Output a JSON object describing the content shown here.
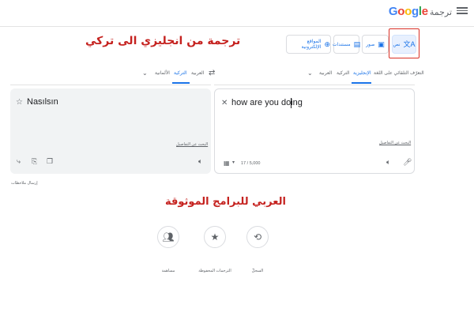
{
  "header": {
    "logo_letters": [
      {
        "char": "G",
        "color": "#4285f4"
      },
      {
        "char": "o",
        "color": "#ea4335"
      },
      {
        "char": "o",
        "color": "#fbbc05"
      },
      {
        "char": "g",
        "color": "#4285f4"
      },
      {
        "char": "l",
        "color": "#34a853"
      },
      {
        "char": "e",
        "color": "#ea4335"
      }
    ],
    "product_name": "ترجمة",
    "menu_icon": "hamburger-menu-icon"
  },
  "modes": [
    {
      "label": "نص",
      "icon": "text-translate-icon",
      "active": true
    },
    {
      "label": "صور",
      "icon": "image-icon",
      "active": false
    },
    {
      "label": "مستندات",
      "icon": "document-icon",
      "active": false
    },
    {
      "label": "المواقع الإلكترونية",
      "icon": "globe-icon",
      "active": false
    }
  ],
  "annotations": {
    "top": "ترجمة من انجليزي الى تركي",
    "middle": "العربي للبرامج الموثوقة"
  },
  "source_langs": {
    "tabs": [
      "التعرّف التلقائي على اللغة",
      "الإنجليزية",
      "التركية",
      "العربية"
    ],
    "active_index": 1
  },
  "target_langs": {
    "tabs": [
      "العربية",
      "التركية",
      "الألمانية"
    ],
    "active_index": 1
  },
  "source": {
    "text": "how are you doing",
    "details_link": "البحث عن التفاصيل",
    "char_count": "17 / 5,000",
    "clear_icon": "close-icon",
    "mic_icon": "microphone-icon",
    "speaker_icon": "speaker-icon",
    "keyboard_icon": "keyboard-icon"
  },
  "target": {
    "text": "Nasılsın",
    "details_link": "البحث عن التفاصيل",
    "star_icon": "star-outline-icon",
    "speaker_icon": "speaker-icon",
    "copy_icon": "copy-icon",
    "rate_icon": "rate-icon",
    "share_icon": "share-icon"
  },
  "feedback": "إرسال ملاحظات",
  "bottom_actions": [
    {
      "label": "السجلّ",
      "icon": "history-icon"
    },
    {
      "label": "الترجمات المحفوظة",
      "icon": "star-filled-icon"
    },
    {
      "label": "مساهمة",
      "icon": "people-icon"
    }
  ],
  "colors": {
    "accent": "#1a73e8",
    "annotation": "#c5221f",
    "highlight_box": "#d93025",
    "panel_bg": "#f1f3f4"
  }
}
